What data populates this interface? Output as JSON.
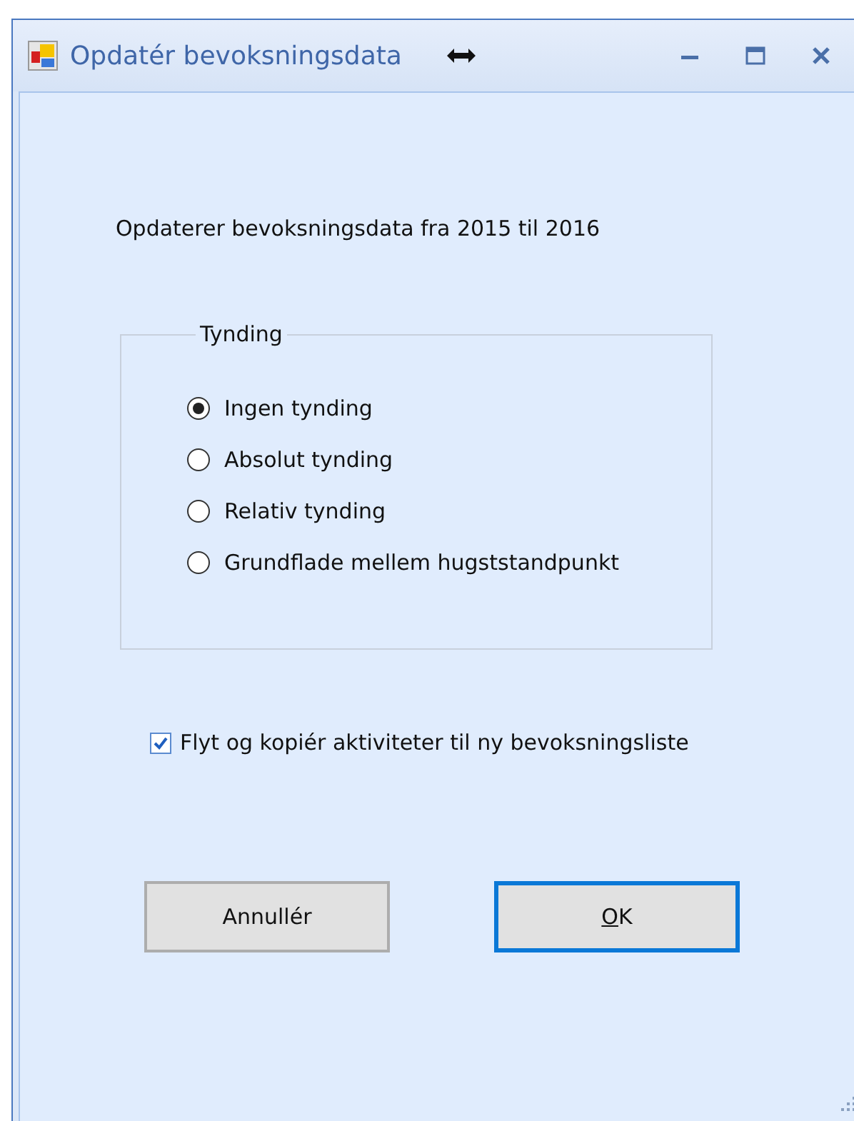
{
  "window": {
    "title": "Opdatér bevoksningsdata"
  },
  "message": "Opdaterer bevoksningsdata fra 2015 til 2016",
  "group": {
    "title": "Tynding",
    "options": [
      {
        "label": "Ingen tynding",
        "selected": true
      },
      {
        "label": "Absolut tynding",
        "selected": false
      },
      {
        "label": "Relativ tynding",
        "selected": false
      },
      {
        "label": "Grundflade mellem hugststandpunkt",
        "selected": false
      }
    ]
  },
  "checkbox": {
    "label": "Flyt og kopiér aktiviteter til ny bevoksningsliste",
    "checked": true
  },
  "buttons": [
    {
      "label": "Annullér",
      "default": false,
      "mnemonic": false
    },
    {
      "label": "OK",
      "default": true,
      "mnemonic": true
    }
  ]
}
